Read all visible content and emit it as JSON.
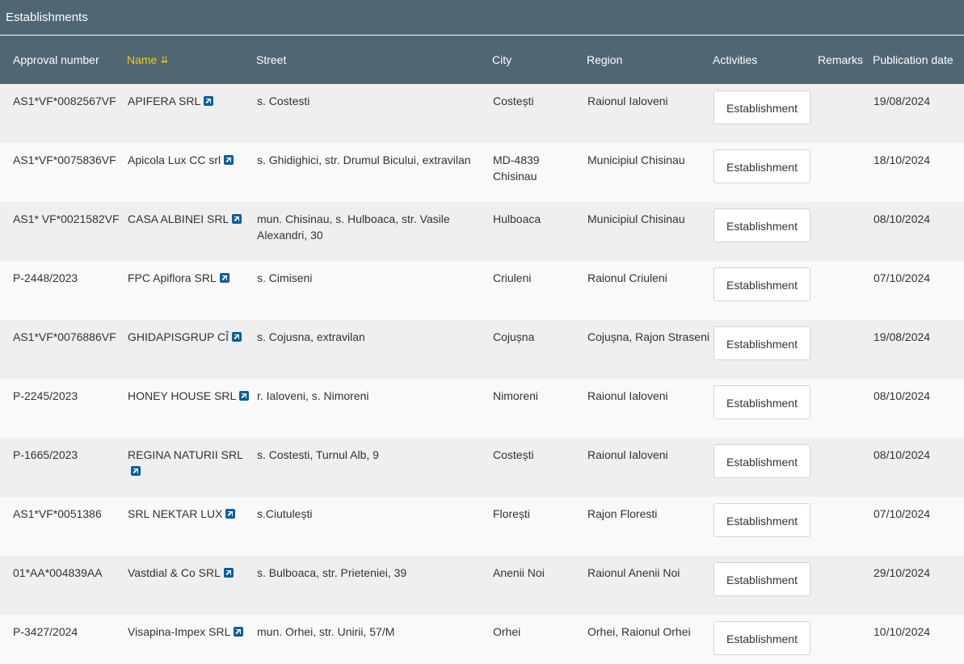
{
  "panel": {
    "title": "Establishments"
  },
  "columns": {
    "approval": "Approval number",
    "name": "Name",
    "street": "Street",
    "city": "City",
    "region": "Region",
    "activities": "Activities",
    "remarks": "Remarks",
    "pub": "Publication date",
    "sort_icon": "sort-descending-icon"
  },
  "rows": [
    {
      "approval": "AS1*VF*0082567VF",
      "name": "APIFERA SRL",
      "street": "s. Costesti",
      "city": "Costești",
      "region": "Raionul Ialoveni",
      "activity": "Establishment",
      "remarks": "",
      "pub": "19/08/2024"
    },
    {
      "approval": "AS1*VF*0075836VF",
      "name": "Apicola Lux CC srl",
      "street": "s. Ghidighici, str. Drumul Bicului, extravilan",
      "city": "MD-4839 Chisinau",
      "region": "Municipiul Chisinau",
      "activity": "Establishment",
      "remarks": "",
      "pub": "18/10/2024"
    },
    {
      "approval": "AS1* VF*0021582VF",
      "name": "CASA ALBINEI SRL",
      "street": "mun. Chisinau, s. Hulboaca, str. Vasile Alexandri, 30",
      "city": "Hulboaca",
      "region": "Municipiul Chisinau",
      "activity": "Establishment",
      "remarks": "",
      "pub": "08/10/2024"
    },
    {
      "approval": "P-2448/2023",
      "name": "FPC Apiflora SRL",
      "street": "s. Cimiseni",
      "city": "Criuleni",
      "region": "Raionul Criuleni",
      "activity": "Establishment",
      "remarks": "",
      "pub": "07/10/2024"
    },
    {
      "approval": "AS1*VF*0076886VF",
      "name": "GHIDAPISGRUP CÎ",
      "street": "s. Cojusna, extravilan",
      "city": "Cojușna",
      "region": "Cojușna, Rajon Straseni",
      "activity": "Establishment",
      "remarks": "",
      "pub": "19/08/2024"
    },
    {
      "approval": "P-2245/2023",
      "name": "HONEY HOUSE SRL",
      "street": "r. Ialoveni, s. Nimoreni",
      "city": "Nimoreni",
      "region": "Raionul Ialoveni",
      "activity": "Establishment",
      "remarks": "",
      "pub": "08/10/2024"
    },
    {
      "approval": "P-1665/2023",
      "name": "REGINA NATURII SRL",
      "street": "s. Costesti, Turnul Alb, 9",
      "city": "Costești",
      "region": "Raionul Ialoveni",
      "activity": "Establishment",
      "remarks": "",
      "pub": "08/10/2024"
    },
    {
      "approval": "AS1*VF*0051386",
      "name": "SRL NEKTAR LUX",
      "street": "s.Ciutulești",
      "city": "Florești",
      "region": "Rajon Floresti",
      "activity": "Establishment",
      "remarks": "",
      "pub": "07/10/2024"
    },
    {
      "approval": "01*AA*004839AA",
      "name": "Vastdial & Co SRL",
      "street": "s. Bulboaca, str. Prieteniei, 39",
      "city": "Anenii Noi",
      "region": "Raionul Anenii Noi",
      "activity": "Establishment",
      "remarks": "",
      "pub": "29/10/2024"
    },
    {
      "approval": "P-3427/2024",
      "name": "Visapina-Impex SRL",
      "street": "mun. Orhei, str. Unirii, 57/M",
      "city": "Orhei",
      "region": "Orhei,   Raionul Orhei",
      "activity": "Establishment",
      "remarks": "",
      "pub": "10/10/2024"
    }
  ]
}
